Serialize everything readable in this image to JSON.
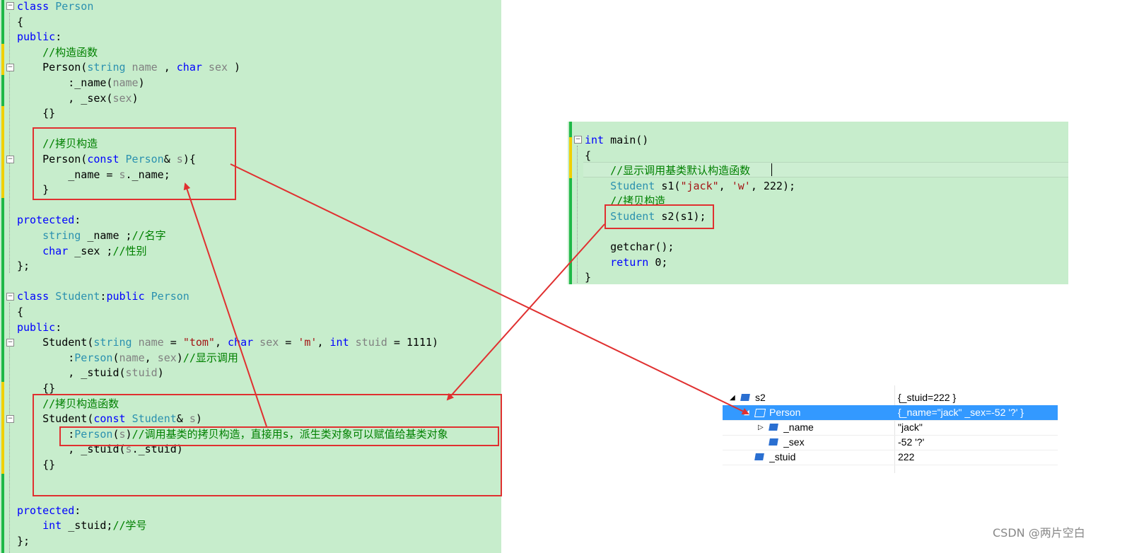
{
  "left_code": [
    {
      "n": "l0",
      "segs": [
        [
          "kw",
          "class "
        ],
        [
          "ty",
          "Person"
        ]
      ]
    },
    {
      "n": "l1",
      "segs": [
        [
          "",
          "{"
        ]
      ]
    },
    {
      "n": "l2",
      "segs": [
        [
          "kw",
          "public"
        ],
        [
          "",
          ":"
        ]
      ]
    },
    {
      "n": "l3",
      "segs": [
        [
          "cm",
          "    //构造函数"
        ]
      ]
    },
    {
      "n": "l4",
      "segs": [
        [
          "",
          "    Person("
        ],
        [
          "ty",
          "string"
        ],
        [
          "pa",
          " name"
        ],
        [
          "",
          " , "
        ],
        [
          "kw",
          "char"
        ],
        [
          "pa",
          " sex"
        ],
        [
          "",
          " )"
        ]
      ]
    },
    {
      "n": "l5",
      "segs": [
        [
          "",
          "        :_name("
        ],
        [
          "pa",
          "name"
        ],
        [
          "",
          ")"
        ]
      ]
    },
    {
      "n": "l6",
      "segs": [
        [
          "",
          "        , _sex("
        ],
        [
          "pa",
          "sex"
        ],
        [
          "",
          ")"
        ]
      ]
    },
    {
      "n": "l7",
      "segs": [
        [
          "",
          "    {}"
        ]
      ]
    },
    {
      "n": "l8",
      "segs": [
        [
          "",
          ""
        ]
      ]
    },
    {
      "n": "l9",
      "segs": [
        [
          "cm",
          "    //拷贝构造"
        ]
      ]
    },
    {
      "n": "l10",
      "segs": [
        [
          "",
          "    Person("
        ],
        [
          "kw",
          "const "
        ],
        [
          "ty",
          "Person"
        ],
        [
          "",
          "& "
        ],
        [
          "pa",
          "s"
        ],
        [
          "",
          ")"
        ],
        [
          "",
          "{"
        ]
      ]
    },
    {
      "n": "l11",
      "segs": [
        [
          "",
          "        _name = "
        ],
        [
          "pa",
          "s"
        ],
        [
          "",
          "._name;"
        ]
      ]
    },
    {
      "n": "l12",
      "segs": [
        [
          "",
          "    }"
        ]
      ]
    },
    {
      "n": "l13",
      "segs": [
        [
          "",
          ""
        ]
      ]
    },
    {
      "n": "l14",
      "segs": [
        [
          "kw",
          "protected"
        ],
        [
          "",
          ":"
        ]
      ]
    },
    {
      "n": "l15",
      "segs": [
        [
          "ty",
          "    string"
        ],
        [
          "",
          " _name ;"
        ],
        [
          "cm",
          "//名字"
        ]
      ]
    },
    {
      "n": "l16",
      "segs": [
        [
          "kw",
          "    char"
        ],
        [
          "",
          " _sex ;"
        ],
        [
          "cm",
          "//性别"
        ]
      ]
    },
    {
      "n": "l17",
      "segs": [
        [
          "",
          "};"
        ]
      ]
    },
    {
      "n": "l18",
      "segs": [
        [
          "",
          ""
        ]
      ]
    },
    {
      "n": "l19",
      "segs": [
        [
          "kw",
          "class "
        ],
        [
          "ty",
          "Student"
        ],
        [
          "",
          ":"
        ],
        [
          "kw",
          "public "
        ],
        [
          "ty",
          "Person"
        ]
      ]
    },
    {
      "n": "l20",
      "segs": [
        [
          "",
          "{"
        ]
      ]
    },
    {
      "n": "l21",
      "segs": [
        [
          "kw",
          "public"
        ],
        [
          "",
          ":"
        ]
      ]
    },
    {
      "n": "l22",
      "segs": [
        [
          "",
          "    Student("
        ],
        [
          "ty",
          "string"
        ],
        [
          "pa",
          " name"
        ],
        [
          "",
          " = "
        ],
        [
          "st",
          "\"tom\""
        ],
        [
          "",
          ", "
        ],
        [
          "kw",
          "char"
        ],
        [
          "pa",
          " sex"
        ],
        [
          "",
          " = "
        ],
        [
          "st",
          "'m'"
        ],
        [
          "",
          ", "
        ],
        [
          "kw",
          "int"
        ],
        [
          "pa",
          " stuid"
        ],
        [
          "",
          " = 1111)"
        ]
      ]
    },
    {
      "n": "l23",
      "segs": [
        [
          "",
          "        :"
        ],
        [
          "ty",
          "Person"
        ],
        [
          "",
          "("
        ],
        [
          "pa",
          "name"
        ],
        [
          "",
          ", "
        ],
        [
          "pa",
          "sex"
        ],
        [
          "",
          ")"
        ],
        [
          "cm",
          "//显示调用"
        ]
      ]
    },
    {
      "n": "l24",
      "segs": [
        [
          "",
          "        , _stuid("
        ],
        [
          "pa",
          "stuid"
        ],
        [
          "",
          ")"
        ]
      ]
    },
    {
      "n": "l25",
      "segs": [
        [
          "",
          "    {}"
        ]
      ]
    },
    {
      "n": "l26",
      "segs": [
        [
          "cm",
          "    //拷贝构造函数"
        ]
      ]
    },
    {
      "n": "l27",
      "segs": [
        [
          "",
          "    Student("
        ],
        [
          "kw",
          "const "
        ],
        [
          "ty",
          "Student"
        ],
        [
          "",
          "& "
        ],
        [
          "pa",
          "s"
        ],
        [
          "",
          ")"
        ]
      ]
    },
    {
      "n": "l28",
      "segs": [
        [
          "",
          "        :"
        ],
        [
          "ty",
          "Person"
        ],
        [
          "",
          "("
        ],
        [
          "pa",
          "s"
        ],
        [
          "",
          ")"
        ],
        [
          "cm",
          "//调用基类的拷贝构造，直接用s，派生类对象可以赋值给基类对象"
        ]
      ]
    },
    {
      "n": "l29",
      "segs": [
        [
          "",
          "        , _stuid("
        ],
        [
          "pa",
          "s"
        ],
        [
          "",
          "._stuid)"
        ]
      ]
    },
    {
      "n": "l30",
      "segs": [
        [
          "",
          "    {}"
        ]
      ]
    },
    {
      "n": "l31",
      "segs": [
        [
          "",
          ""
        ]
      ]
    },
    {
      "n": "l32",
      "segs": [
        [
          "",
          ""
        ]
      ]
    },
    {
      "n": "l33",
      "segs": [
        [
          "kw",
          "protected"
        ],
        [
          "",
          ":"
        ]
      ]
    },
    {
      "n": "l34",
      "segs": [
        [
          "kw",
          "    int"
        ],
        [
          "",
          " _stuid;"
        ],
        [
          "cm",
          "//学号"
        ]
      ]
    },
    {
      "n": "l35",
      "segs": [
        [
          "",
          "};"
        ]
      ]
    }
  ],
  "main_code": [
    {
      "n": "m0",
      "segs": [
        [
          "kw",
          "int"
        ],
        [
          "",
          " main()"
        ]
      ]
    },
    {
      "n": "m1",
      "segs": [
        [
          "",
          "{"
        ]
      ]
    },
    {
      "n": "m2",
      "segs": [
        [
          "cm",
          "    //显示调用基类默认构造函数"
        ]
      ]
    },
    {
      "n": "m3",
      "segs": [
        [
          "ty",
          "    Student"
        ],
        [
          "",
          " s1("
        ],
        [
          "st",
          "\"jack\""
        ],
        [
          "",
          ", "
        ],
        [
          "st",
          "'w'"
        ],
        [
          "",
          ", 222);"
        ]
      ]
    },
    {
      "n": "m4",
      "segs": [
        [
          "cm",
          "    //拷贝构造"
        ]
      ]
    },
    {
      "n": "m5",
      "segs": [
        [
          "ty",
          "    Student"
        ],
        [
          "",
          " s2(s1);"
        ]
      ]
    },
    {
      "n": "m6",
      "segs": [
        [
          "",
          ""
        ]
      ]
    },
    {
      "n": "m7",
      "segs": [
        [
          "",
          "    getchar();"
        ]
      ]
    },
    {
      "n": "m8",
      "segs": [
        [
          "kw",
          "    return"
        ],
        [
          "",
          " 0;"
        ]
      ]
    },
    {
      "n": "m9",
      "segs": [
        [
          "",
          "}"
        ]
      ]
    }
  ],
  "watch": {
    "rows": [
      {
        "name": "s2",
        "value": "{_stuid=222 }",
        "indent": 0,
        "expander": "open",
        "icon": "object-icon",
        "selected": false
      },
      {
        "name": "Person",
        "value": "{_name=\"jack\" _sex=-52 '?' }",
        "indent": 1,
        "expander": "open",
        "icon": "base-class-icon",
        "selected": true
      },
      {
        "name": "_name",
        "value": "\"jack\"",
        "indent": 2,
        "expander": "closed",
        "icon": "protected-field-icon",
        "selected": false
      },
      {
        "name": "_sex",
        "value": "-52 '?'",
        "indent": 2,
        "expander": "none",
        "icon": "protected-field-icon",
        "selected": false
      },
      {
        "name": "_stuid",
        "value": "222",
        "indent": 1,
        "expander": "none",
        "icon": "protected-field-icon",
        "selected": false
      }
    ]
  },
  "watermark": "CSDN @两片空白",
  "colors": {
    "editor_bg": "#c7edcc",
    "annotation": "#e03030",
    "keyword": "#0000ff",
    "type": "#2b91af",
    "comment": "#008000",
    "string": "#a31515",
    "param": "#808080",
    "selection": "#3399ff"
  }
}
